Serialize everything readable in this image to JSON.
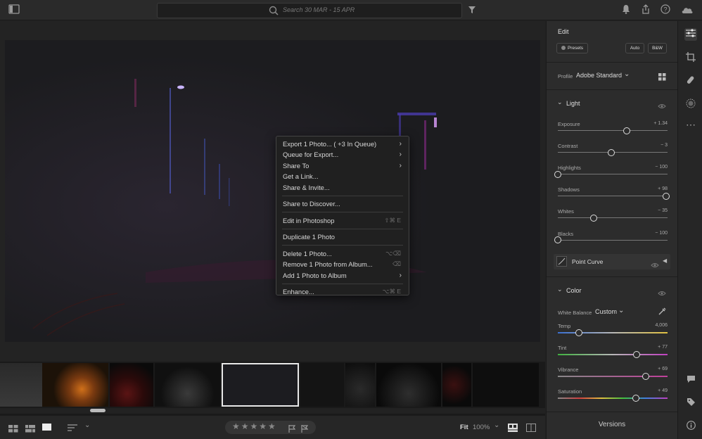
{
  "search": {
    "placeholder": "Search 30 MAR - 15 APR"
  },
  "context_menu": [
    {
      "label": "Export 1 Photo...  ( +3 In Queue)",
      "shortcut": "",
      "submenu": true
    },
    {
      "label": "Queue for Export...",
      "shortcut": "",
      "submenu": true
    },
    {
      "label": "Share To",
      "shortcut": "",
      "submenu": true
    },
    {
      "label": "Get a Link...",
      "shortcut": "",
      "submenu": false
    },
    {
      "label": "Share & Invite...",
      "shortcut": "",
      "submenu": false
    },
    {
      "label": "Share to Discover...",
      "shortcut": "",
      "submenu": false
    },
    {
      "label": "Edit in Photoshop",
      "shortcut": "⇧⌘ E",
      "submenu": false
    },
    {
      "label": "Duplicate 1 Photo",
      "shortcut": "",
      "submenu": false
    },
    {
      "label": "Delete 1 Photo...",
      "shortcut": "⌥⌫",
      "submenu": false
    },
    {
      "label": "Remove 1 Photo from Album...",
      "shortcut": "⌫",
      "submenu": false
    },
    {
      "label": "Add 1 Photo to Album",
      "shortcut": "",
      "submenu": true
    },
    {
      "label": "Enhance...",
      "shortcut": "⌥⌘ E",
      "submenu": false
    }
  ],
  "edit_panel": {
    "title": "Edit",
    "presets_label": "Presets",
    "auto_label": "Auto",
    "bw_label": "B&W",
    "profile_label": "Profile",
    "profile_value": "Adobe Standard",
    "light": {
      "title": "Light",
      "sliders": [
        {
          "label": "Exposure",
          "value": "+ 1.34",
          "pos": 0.63
        },
        {
          "label": "Contrast",
          "value": "− 3",
          "pos": 0.49
        },
        {
          "label": "Highlights",
          "value": "− 100",
          "pos": 0.0
        },
        {
          "label": "Shadows",
          "value": "+ 98",
          "pos": 0.99
        },
        {
          "label": "Whites",
          "value": "− 35",
          "pos": 0.33
        },
        {
          "label": "Blacks",
          "value": "− 100",
          "pos": 0.0
        }
      ]
    },
    "point_curve_label": "Point Curve",
    "color": {
      "title": "Color",
      "wb_label": "White Balance",
      "wb_value": "Custom",
      "sliders": [
        {
          "label": "Temp",
          "value": "4,006",
          "pos": 0.19
        },
        {
          "label": "Tint",
          "value": "+ 77",
          "pos": 0.72
        },
        {
          "label": "Vibrance",
          "value": "+ 69",
          "pos": 0.8
        },
        {
          "label": "Saturation",
          "value": "+ 49",
          "pos": 0.71
        }
      ]
    },
    "versions_label": "Versions"
  },
  "bottom": {
    "fit_label": "Fit",
    "zoom_label": "100%"
  },
  "colors": {
    "accent": "#2d8ceb",
    "panel": "#2c2c2c"
  }
}
